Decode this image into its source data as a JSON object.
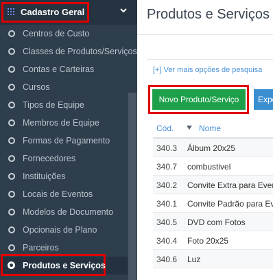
{
  "sidebar": {
    "section_title": "Cadastro Geral",
    "items": [
      {
        "label": "Centros de Custo",
        "active": false
      },
      {
        "label": "Classes de Produtos/Serviços",
        "active": false
      },
      {
        "label": "Contas e Carteiras",
        "active": false
      },
      {
        "label": "Cursos",
        "active": false
      },
      {
        "label": "Tipos de Equipe",
        "active": false
      },
      {
        "label": "Membros de Equipe",
        "active": false
      },
      {
        "label": "Formas de Pagamento",
        "active": false
      },
      {
        "label": "Fornecedores",
        "active": false
      },
      {
        "label": "Instituições",
        "active": false
      },
      {
        "label": "Locais de Eventos",
        "active": false
      },
      {
        "label": "Modelos de Documento",
        "active": false
      },
      {
        "label": "Opcionais de Plano",
        "active": false
      },
      {
        "label": "Parceiros",
        "active": false
      },
      {
        "label": "Produtos e Serviços",
        "active": true
      }
    ]
  },
  "main": {
    "title": "Produtos e Serviços",
    "more_options_link": "[+] Ver mais opções de pesquisa",
    "new_button": "Novo Produto/Serviço",
    "export_button": "Expo",
    "table": {
      "headers": {
        "code": "Cód.",
        "name": "Nome"
      },
      "rows": [
        {
          "code": "340.3",
          "name": "Álbum 20x25"
        },
        {
          "code": "340.7",
          "name": "combustivel"
        },
        {
          "code": "340.2",
          "name": "Convite Extra para Event"
        },
        {
          "code": "340.1",
          "name": "Convite Padrão para Eve"
        },
        {
          "code": "340.5",
          "name": "DVD com Fotos"
        },
        {
          "code": "340.4",
          "name": "Foto 20x25"
        },
        {
          "code": "340.6",
          "name": "Luz"
        }
      ]
    }
  },
  "colors": {
    "sidebar_bg": "#2f3e4c",
    "highlight_red": "#e00000",
    "primary_green": "#1ea04b",
    "link_blue": "#4a90d6"
  }
}
